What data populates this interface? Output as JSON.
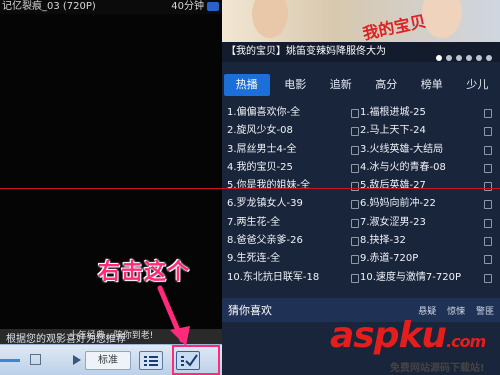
{
  "video": {
    "title_fragment": "记亿裂痕_03 (720P)",
    "duration": "40分钟",
    "slogan": "十年经典，陪你到老!"
  },
  "controls": {
    "standard_label": "标准"
  },
  "annotation": {
    "text": "右击这个"
  },
  "banner": {
    "overlay_text": "我的宝贝",
    "caption": "【我的宝贝】姚笛变辣妈降服佟大为"
  },
  "tabs": [
    "热播",
    "电影",
    "追新",
    "高分",
    "榜单",
    "少儿"
  ],
  "ranking": {
    "left": [
      "1.偏偏喜欢你-全",
      "2.旋风少女-08",
      "3.屌丝男士4-全",
      "4.我的宝贝-25",
      "5.你是我的姐妹-全",
      "6.罗龙镇女人-39",
      "7.两生花-全",
      "8.爸爸父亲爹-26",
      "9.生死连-全",
      "10.东北抗日联军-18"
    ],
    "right": [
      "1.福根进城-25",
      "2.马上天下-24",
      "3.火线英雄-大结局",
      "4.冰与火的青春-08",
      "5.敌后英雄-27",
      "6.妈妈向前冲-22",
      "7.淑女涩男-23",
      "8.抉择-32",
      "9.赤道-720P",
      "10.速度与激情7-720P"
    ]
  },
  "guess": {
    "title": "猜你喜欢",
    "options": [
      "悬疑",
      "惊悚",
      "警匪"
    ],
    "description": "根据您的观影喜好为您推荐"
  },
  "watermark": {
    "logo": "aspku",
    "domain": ".com",
    "subtitle": "免费网站源码下载站!"
  },
  "colors": {
    "active_tab": "#1c6fd8",
    "annotation": "#ff2a7a",
    "red_line": "#c8141e"
  }
}
